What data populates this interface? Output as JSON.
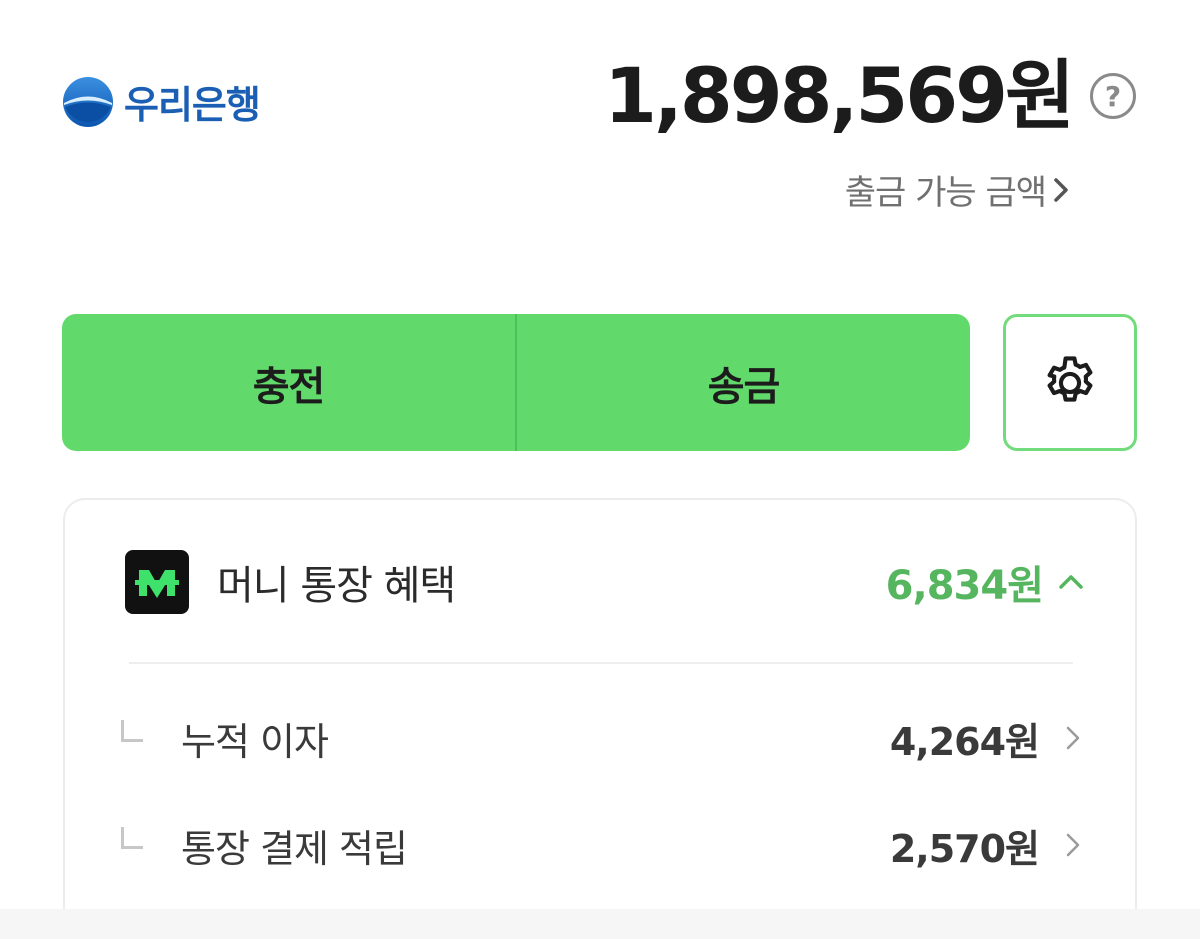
{
  "header": {
    "bank_name": "우리은행",
    "balance": "1,898,569원",
    "help_symbol": "?",
    "withdraw_label": "출금 가능 금액"
  },
  "actions": {
    "charge_label": "충전",
    "transfer_label": "송금",
    "settings_icon": "gear-icon"
  },
  "benefits": {
    "title": "머니 통장 혜택",
    "total": "6,834원",
    "logo_icon": "m-logo-icon",
    "items": [
      {
        "label": "누적 이자",
        "value": "4,264원"
      },
      {
        "label": "통장 결제 적립",
        "value": "2,570원"
      }
    ]
  },
  "colors": {
    "accent_green": "#62da6b",
    "benefit_green": "#56b65f",
    "bank_blue": "#1a5fb4"
  }
}
